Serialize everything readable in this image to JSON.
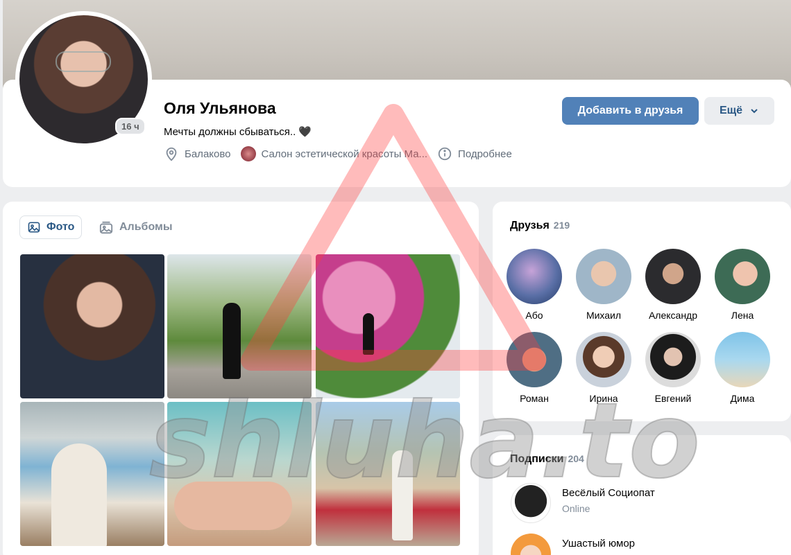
{
  "profile": {
    "name": "Оля Ульянова",
    "status": "Мечты должны сбываться.. 🖤",
    "last_seen": "16 ч",
    "city": "Балаково",
    "company": "Салон эстетической красоты Ма...",
    "details": "Подробнее",
    "add_friend": "Добавить в друзья",
    "more": "Ещё"
  },
  "tabs": {
    "photos": "Фото",
    "albums": "Альбомы"
  },
  "friends": {
    "title": "Друзья",
    "count": "219",
    "items": [
      {
        "name": "Або"
      },
      {
        "name": "Михаил"
      },
      {
        "name": "Александр"
      },
      {
        "name": "Лена"
      },
      {
        "name": "Роман"
      },
      {
        "name": "Ирина"
      },
      {
        "name": "Евгений"
      },
      {
        "name": "Дима"
      }
    ]
  },
  "subscriptions": {
    "title": "Подписки",
    "count": "204",
    "items": [
      {
        "name": "Весёлый Социопат",
        "status": "Online"
      },
      {
        "name": "Ушастый юмор",
        "status": ""
      }
    ]
  },
  "watermark": {
    "text": "shluha.to"
  },
  "colors": {
    "accent": "#5181b8",
    "link": "#2a5885",
    "muted": "#818c99",
    "bg": "#edeef0"
  }
}
